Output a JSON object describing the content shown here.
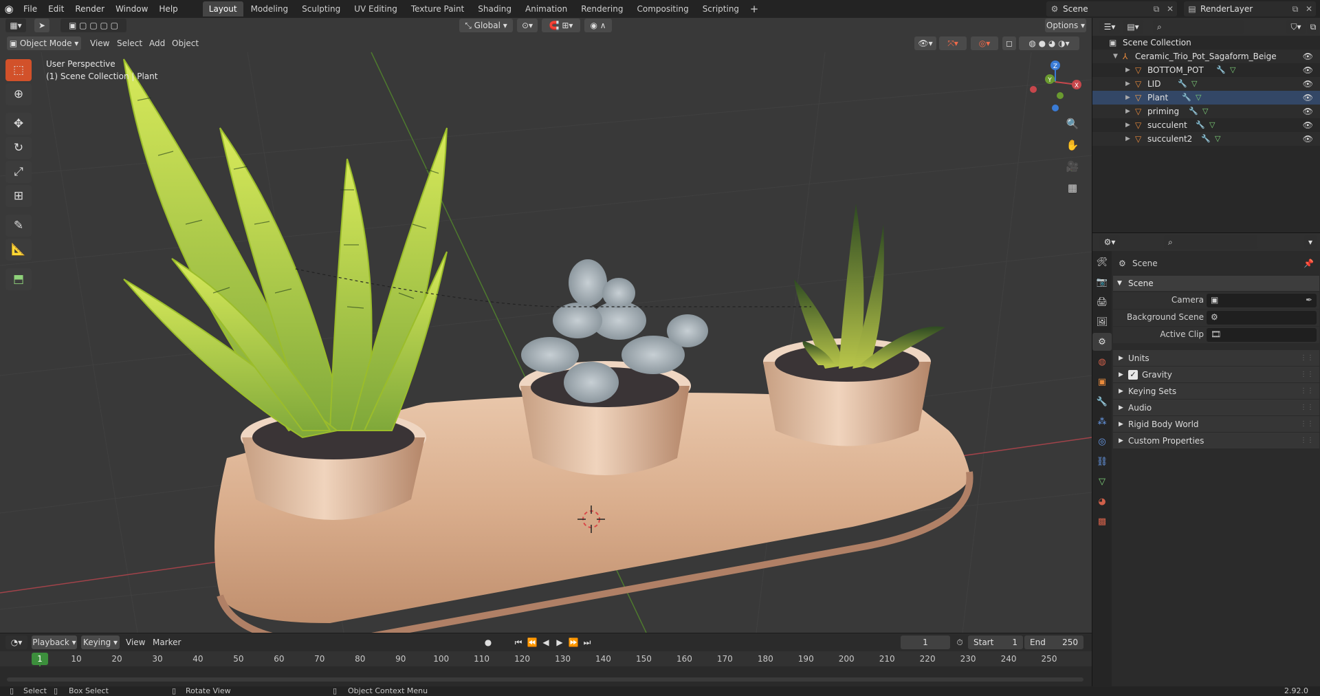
{
  "menu": [
    "File",
    "Edit",
    "Render",
    "Window",
    "Help"
  ],
  "workspaces": [
    "Layout",
    "Modeling",
    "Sculpting",
    "UV Editing",
    "Texture Paint",
    "Shading",
    "Animation",
    "Rendering",
    "Compositing",
    "Scripting"
  ],
  "active_workspace": "Layout",
  "scene_name": "Scene",
  "view_layer": "RenderLayer",
  "viewport": {
    "mode": "Object Mode",
    "menus": [
      "View",
      "Select",
      "Add",
      "Object"
    ],
    "orientation": "Global",
    "options_label": "Options",
    "overlay_line1": "User Perspective",
    "overlay_line2": "(1) Scene Collection | Plant"
  },
  "gizmo": {
    "z": "Z",
    "y": "Y",
    "x": "X"
  },
  "timeline": {
    "menus": [
      "Playback",
      "Keying",
      "View",
      "Marker"
    ],
    "current_frame": "1",
    "start_label": "Start",
    "start": "1",
    "end_label": "End",
    "end": "250",
    "ticks": [
      "1",
      "10",
      "20",
      "30",
      "40",
      "50",
      "60",
      "70",
      "80",
      "90",
      "100",
      "110",
      "120",
      "130",
      "140",
      "150",
      "160",
      "170",
      "180",
      "190",
      "200",
      "210",
      "220",
      "230",
      "240",
      "250"
    ]
  },
  "status": {
    "select": "Select",
    "box_select": "Box Select",
    "rotate_view": "Rotate View",
    "context_menu": "Object Context Menu",
    "version": "2.92.0"
  },
  "outliner": {
    "root": "Scene Collection",
    "collection": "Ceramic_Trio_Pot_Sagaform_Beige",
    "objects": [
      "BOTTOM_POT",
      "LID",
      "Plant",
      "priming",
      "succulent",
      "succulent2"
    ]
  },
  "properties": {
    "context": "Scene",
    "panel": "Scene",
    "fields": [
      {
        "label": "Camera"
      },
      {
        "label": "Background Scene"
      },
      {
        "label": "Active Clip"
      }
    ],
    "subpanels": [
      "Units",
      "Gravity",
      "Keying Sets",
      "Audio",
      "Rigid Body World",
      "Custom Properties"
    ]
  },
  "colors": {
    "accent": "#4b7fc6",
    "axis_x": "#c7474c",
    "axis_y": "#6a9a2f",
    "axis_z": "#3a7bd5",
    "playhead": "#3c8f3c",
    "object_orange": "#e88a3c"
  }
}
